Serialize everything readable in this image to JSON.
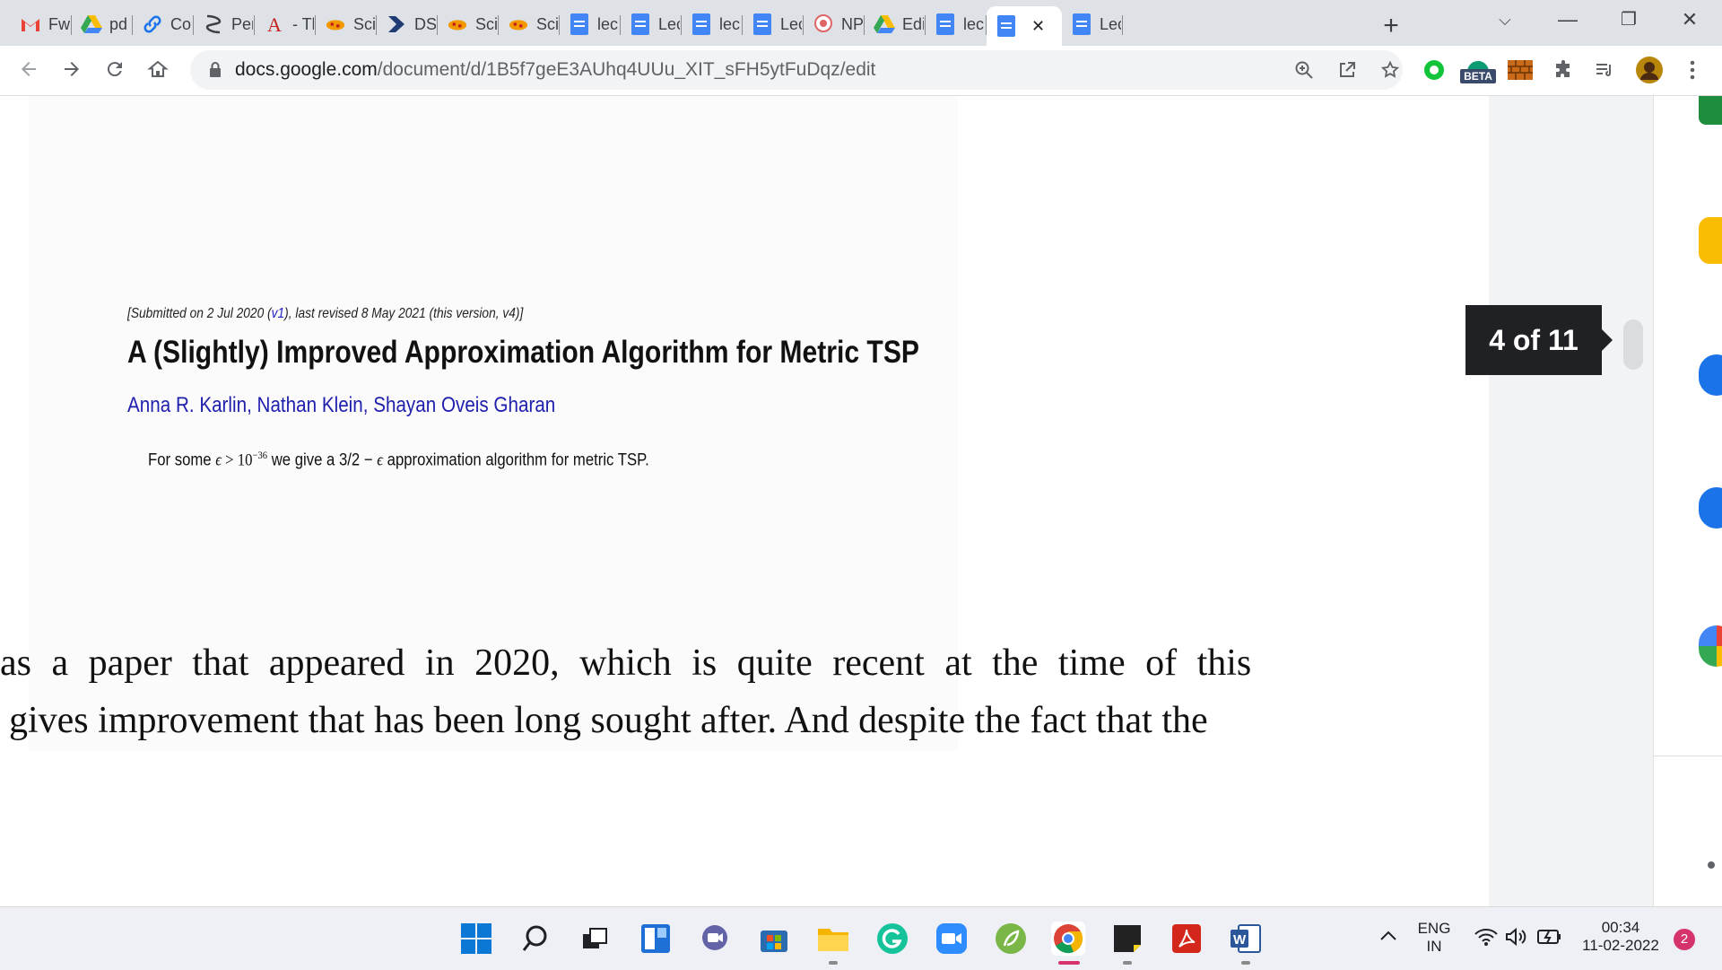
{
  "browser": {
    "tabs": [
      {
        "label": "Fw",
        "icon": "gmail-icon"
      },
      {
        "label": "pd",
        "icon": "google-drive-icon"
      },
      {
        "label": "Co",
        "icon": "link-icon"
      },
      {
        "label": "Per",
        "icon": "perplexity-icon"
      },
      {
        "label": "- Tl",
        "icon": "letter-a-icon"
      },
      {
        "label": "Sci",
        "icon": "sci-hub-icon"
      },
      {
        "label": "DS",
        "icon": "play-icon"
      },
      {
        "label": "Sci",
        "icon": "sci-hub-icon"
      },
      {
        "label": "Sci",
        "icon": "sci-hub-icon"
      },
      {
        "label": "lec",
        "icon": "google-docs-icon"
      },
      {
        "label": "Lec",
        "icon": "google-docs-icon"
      },
      {
        "label": "lec",
        "icon": "google-docs-icon"
      },
      {
        "label": "Lec",
        "icon": "google-docs-icon"
      },
      {
        "label": "NP",
        "icon": "nptel-icon"
      },
      {
        "label": "Edi",
        "icon": "google-drive-icon"
      },
      {
        "label": "lec",
        "icon": "google-docs-icon"
      },
      {
        "label": "",
        "icon": "google-docs-icon",
        "active": true
      },
      {
        "label": "Lec",
        "icon": "google-docs-icon"
      }
    ],
    "close_tab_glyph": "✕",
    "new_tab_glyph": "+",
    "window_buttons": {
      "tab_search": "⌵",
      "minimize": "—",
      "restore": "❐",
      "close": "✕"
    },
    "url_host": "docs.google.com",
    "url_path": "/document/d/1B5f7geE3AUhq4UUu_XIT_sFH5ytFuDqz/edit",
    "extension_badge": "BETA"
  },
  "document": {
    "submitted_prefix": "[Submitted on 2 Jul 2020 (",
    "submitted_link": "v1",
    "submitted_suffix": "), last revised 8 May 2021 (this version, v4)]",
    "paper_title": "A (Slightly) Improved Approximation Algorithm for Metric TSP",
    "authors": "Anna R. Karlin, Nathan Klein, Shayan Oveis Gharan",
    "abstract_pre": "For some ",
    "abstract_eps": "ϵ",
    "abstract_gt": " > 10",
    "abstract_exp": "−36",
    "abstract_mid": " we give a 3/2 − ",
    "abstract_eps2": "ϵ",
    "abstract_post": " approximation algorithm for metric TSP.",
    "body_line_1": "as a paper that appeared in 2020, which is quite recent at the time of this",
    "body_line_2": "gives improvement that has been long sought after. And despite the fact that the",
    "page_indicator": "4 of 11"
  },
  "taskbar": {
    "language_top": "ENG",
    "language_bottom": "IN",
    "time": "00:34",
    "date": "11-02-2022",
    "notification_count": "2"
  }
}
